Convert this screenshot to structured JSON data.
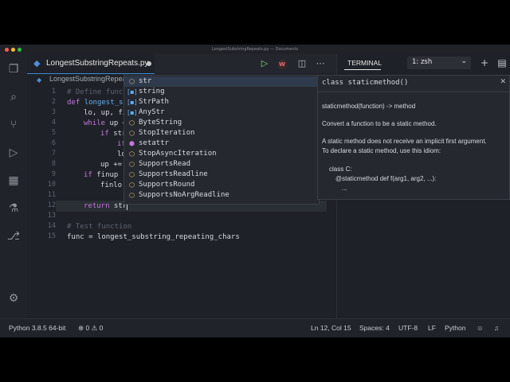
{
  "window": {
    "title": "LongestSubstringRepeats.py — Documents"
  },
  "tab": {
    "label": "LongestSubstringRepeats.py",
    "icon": "python-file-icon"
  },
  "breadcrumb": {
    "label": "LongestSubstringRepea"
  },
  "toolbar": {
    "run_icon": "play-icon",
    "w_badge": "W"
  },
  "gutter": {
    "lines": [
      "1",
      "2",
      "3",
      "4",
      "5",
      "6",
      "7",
      "8",
      "9",
      "10",
      "11",
      "12",
      "13",
      "14",
      "15"
    ]
  },
  "code": {
    "l1": "# Define funct",
    "l2_kw": "def ",
    "l2_fn": "longest_su",
    "l3": "lo, up, fi",
    "l4_kw": "while",
    "l4_rest": " up <",
    "l5_kw": "if",
    "l5_rest": " str",
    "l6_kw": "if",
    "l7": "lo",
    "l8": "up +=",
    "l9_kw": "if",
    "l9_rest": " finup -",
    "l10": "finlo,",
    "l11": "",
    "l12_kw": "return",
    "l12_rest": " str",
    "l14": "# Test function",
    "l15": "func = longest_substring_repeating_chars"
  },
  "suggestions": [
    {
      "label": "str",
      "icon": "class-icon"
    },
    {
      "label": "string",
      "icon": "module-icon"
    },
    {
      "label": "StrPath",
      "icon": "variable-icon"
    },
    {
      "label": "AnyStr",
      "icon": "variable-icon"
    },
    {
      "label": "ByteString",
      "icon": "class-icon"
    },
    {
      "label": "StopIteration",
      "icon": "class-icon"
    },
    {
      "label": "setattr",
      "icon": "function-icon"
    },
    {
      "label": "StopAsyncIteration",
      "icon": "class-icon"
    },
    {
      "label": "SupportsRead",
      "icon": "class-icon"
    },
    {
      "label": "SupportsReadline",
      "icon": "class-icon"
    },
    {
      "label": "SupportsRound",
      "icon": "class-icon"
    },
    {
      "label": "SupportsNoArgReadline",
      "icon": "class-icon"
    }
  ],
  "docs": {
    "signature": "class staticmethod()",
    "line1": "staticmethod(function) -> method",
    "line2": "Convert a function to be a static method.",
    "line3": "A static method does not receive an implicit first argument.",
    "line4": "To declare a static method, use this idiom:",
    "line5": "class C:",
    "line6": "@staticmethod def f(arg1, arg2, ...):",
    "line7": "..."
  },
  "panel": {
    "tab_label": "TERMINAL",
    "terminal_select": "1: zsh"
  },
  "statusbar": {
    "python": "Python 3.8.5 64-bit",
    "problems": "0",
    "warnings": "0",
    "cursor": "Ln 12, Col 15",
    "spaces": "Spaces: 4",
    "encoding": "UTF-8",
    "eol": "LF",
    "language": "Python"
  }
}
